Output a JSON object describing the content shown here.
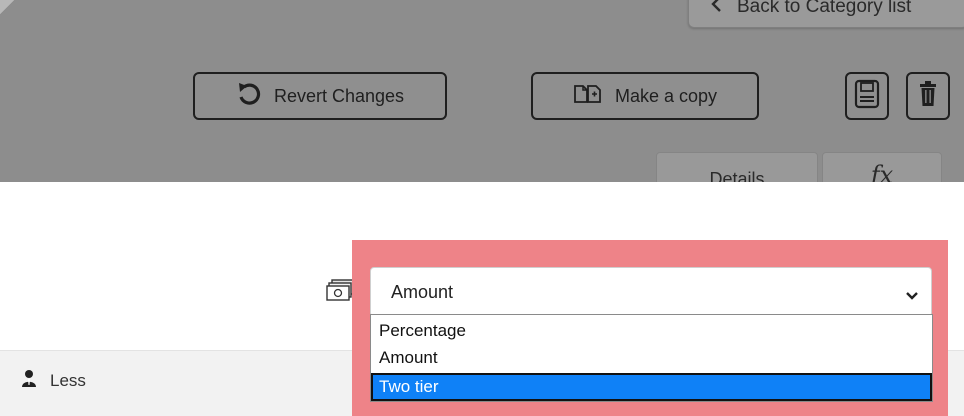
{
  "header": {
    "back_label": "Back to Category list"
  },
  "toolbar": {
    "revert_label": "Revert Changes",
    "copy_label": "Make a copy"
  },
  "tabs": [
    {
      "label": "Details"
    },
    {
      "label": "fx"
    }
  ],
  "type_select": {
    "value": "Amount",
    "options": [
      "Percentage",
      "Amount",
      "Two tier"
    ],
    "highlighted": "Two tier"
  },
  "footer": {
    "less_label": "Less"
  },
  "colors": {
    "overlay_gray": "#8d8d8d",
    "highlight": "#ee8388",
    "selected_option": "#0f81f7"
  },
  "icons": {
    "back": "chevron-left-icon",
    "revert": "undo-icon",
    "copy": "copy-icon",
    "save": "save-icon",
    "delete": "trash-icon",
    "amount": "money-icon",
    "dropdown": "chevron-down-icon",
    "less": "user-icon"
  }
}
